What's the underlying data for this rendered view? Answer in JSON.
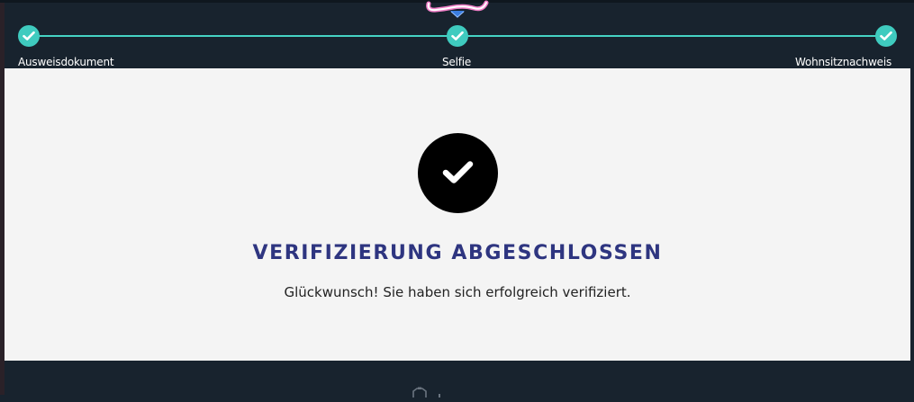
{
  "stepper": {
    "steps": [
      {
        "label": "Ausweisdokument",
        "status": "completed"
      },
      {
        "label": "Selfie",
        "status": "completed"
      },
      {
        "label": "Wohnsitznachweis",
        "status": "completed"
      }
    ],
    "accent_color": "#3fcbbf"
  },
  "logo": {
    "icon": "casino-logo"
  },
  "verification": {
    "icon": "checkmark-icon",
    "title": "VERIFIZIERUNG ABGESCHLOSSEN",
    "message": "Glückwunsch! Sie haben sich erfolgreich verifiziert.",
    "title_color": "#2e3580"
  },
  "colors": {
    "background": "#18232e",
    "card": "#f4f4f4"
  }
}
